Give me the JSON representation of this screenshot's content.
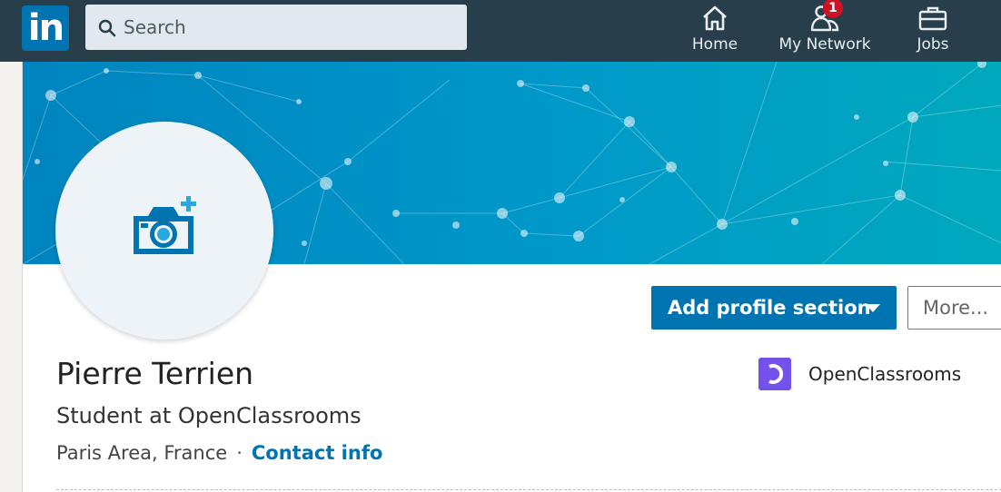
{
  "header": {
    "logo_text": "in",
    "search": {
      "placeholder": "Search",
      "value": ""
    },
    "nav": [
      {
        "label": "Home",
        "icon": "home-icon"
      },
      {
        "label": "My Network",
        "icon": "network-icon",
        "badge": "1"
      },
      {
        "label": "Jobs",
        "icon": "briefcase-icon"
      }
    ]
  },
  "profile": {
    "name": "Pierre Terrien",
    "headline": "Student at OpenClassrooms",
    "location": "Paris Area, France",
    "separator": "·",
    "contact_info_label": "Contact info",
    "actions": {
      "add_section_label": "Add profile section",
      "more_label": "More..."
    },
    "company": {
      "name": "OpenClassrooms",
      "logo_color": "#7451eb"
    }
  },
  "colors": {
    "nav_bg": "#283e4a",
    "brand_blue": "#0073b1",
    "badge_red": "#d11124",
    "banner_start": "#0084bf",
    "banner_end": "#00a9bd"
  }
}
